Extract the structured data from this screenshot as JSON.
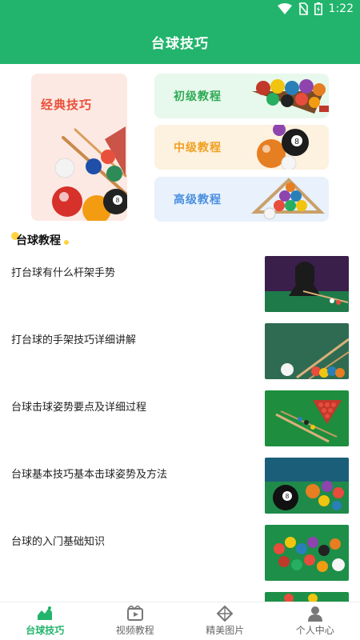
{
  "status_bar": {
    "time": "1:22",
    "icons": [
      "wifi-icon",
      "no-sim-icon",
      "battery-icon"
    ]
  },
  "app_bar": {
    "title": "台球技巧"
  },
  "features": {
    "big_card": {
      "label": "经典技巧",
      "color": "#e9503b",
      "bg": "#fde9e3"
    },
    "small_cards": [
      {
        "label": "初级教程",
        "color": "#2faa55",
        "bg": "#e7f8ec"
      },
      {
        "label": "中级教程",
        "color": "#f0a020",
        "bg": "#fdf1df"
      },
      {
        "label": "高级教程",
        "color": "#4a8fe0",
        "bg": "#e8f1fc"
      }
    ]
  },
  "section": {
    "title": "台球教程"
  },
  "articles": [
    {
      "title": "打台球有什么杆架手势"
    },
    {
      "title": "打台球的手架技巧详细讲解"
    },
    {
      "title": "台球击球姿势要点及详细过程"
    },
    {
      "title": "台球基本技巧基本击球姿势及方法"
    },
    {
      "title": "台球的入门基础知识"
    }
  ],
  "bottom_nav": {
    "items": [
      {
        "label": "台球技巧",
        "icon": "chart-icon",
        "active": true
      },
      {
        "label": "视频教程",
        "icon": "video-icon",
        "active": false
      },
      {
        "label": "精美图片",
        "icon": "diamond-icon",
        "active": false
      },
      {
        "label": "个人中心",
        "icon": "person-icon",
        "active": false
      }
    ]
  },
  "colors": {
    "primary": "#22b46c",
    "section_dot": "#ffd23f"
  }
}
